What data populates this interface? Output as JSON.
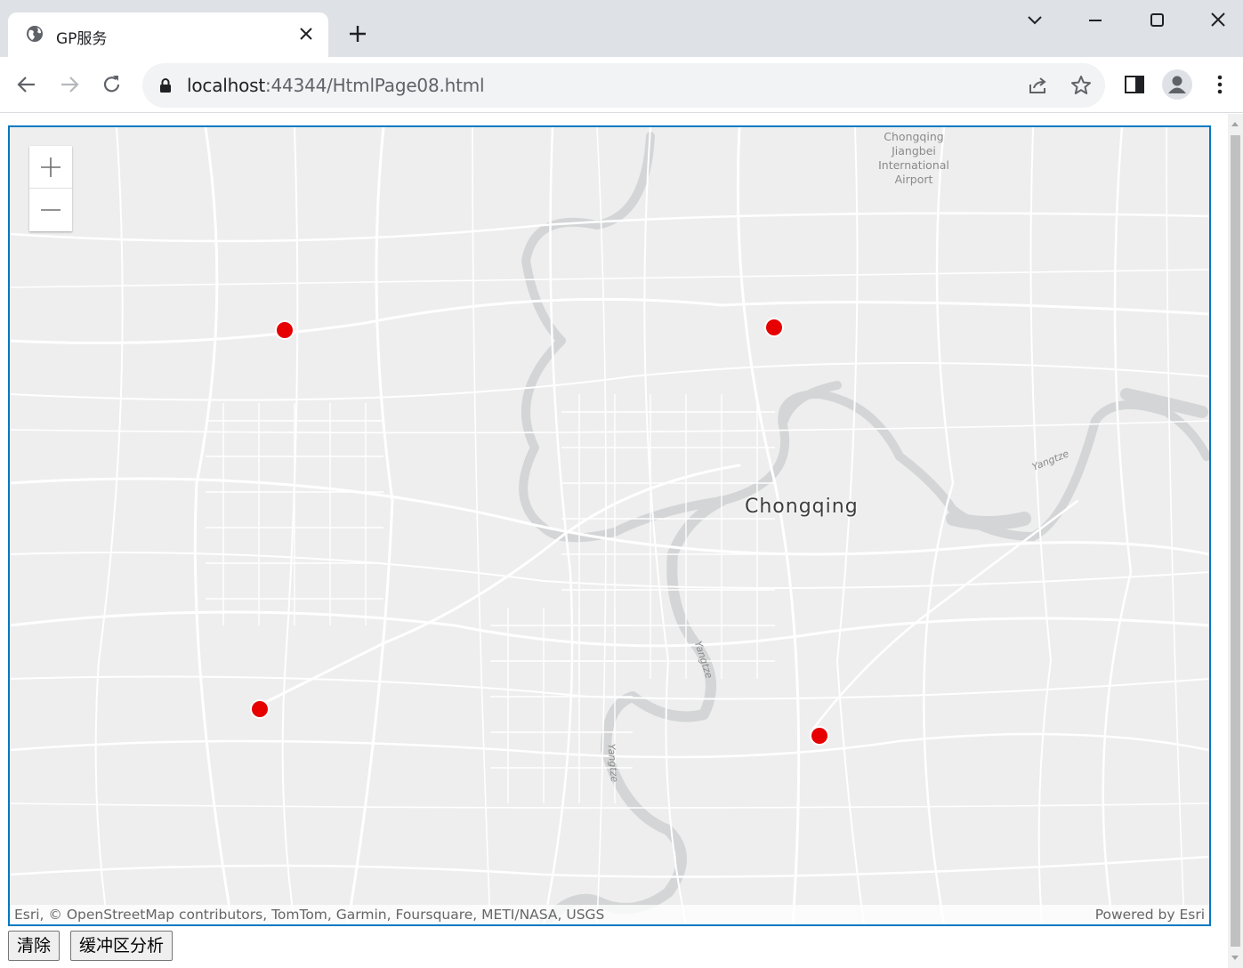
{
  "browser": {
    "tab_title": "GP服务",
    "url_host": "localhost",
    "url_rest": ":44344/HtmlPage08.html"
  },
  "map": {
    "city_label": "Chongqing",
    "airport_label_lines": [
      "Chongqing",
      "Jiangbei",
      "International",
      "Airport"
    ],
    "river_labels": [
      "Yangtze",
      "Yangtze",
      "Yangtze"
    ],
    "attribution": "Esri, © OpenStreetMap contributors, TomTom, Garmin, Foursquare, METI/NASA, USGS",
    "powered_by": "Powered by Esri",
    "marker_color": "#e60000",
    "marker_count": 4
  },
  "buttons": {
    "clear": "清除",
    "buffer": "缓冲区分析"
  }
}
